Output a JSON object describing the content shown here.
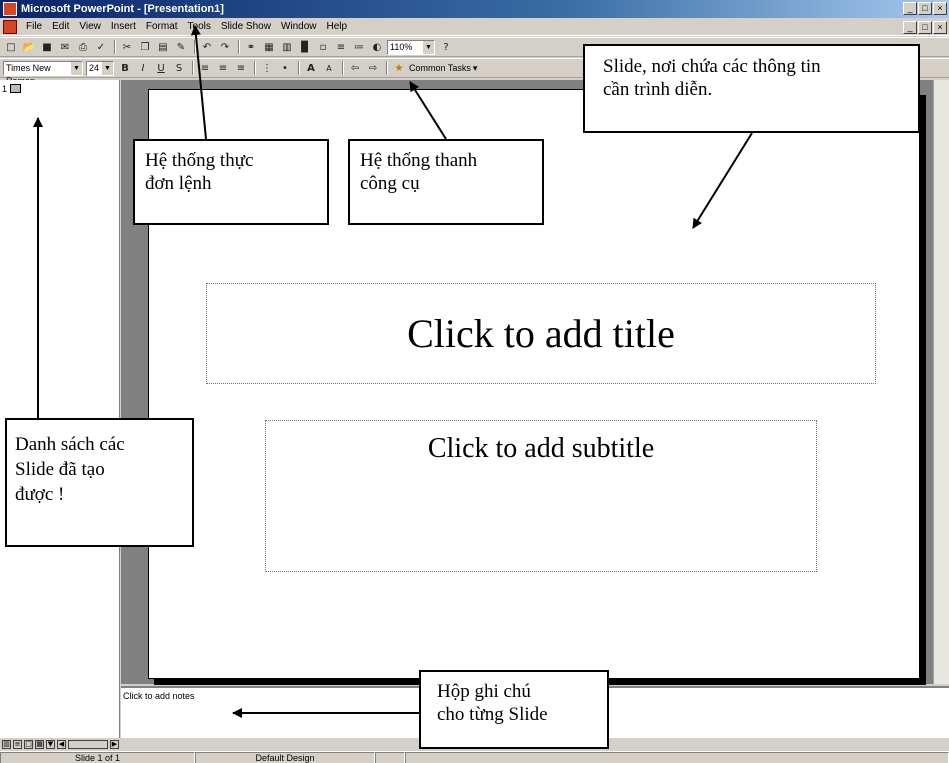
{
  "window": {
    "title": "Microsoft PowerPoint - [Presentation1]",
    "controls": [
      "_",
      "□",
      "×"
    ],
    "doc_controls": [
      "_",
      "□",
      "×"
    ]
  },
  "menu": {
    "items": [
      "File",
      "Edit",
      "View",
      "Insert",
      "Format",
      "Tools",
      "Slide Show",
      "Window",
      "Help"
    ]
  },
  "standard_toolbar": {
    "zoom": "110%",
    "help_icon": "?",
    "icons": [
      "new-icon",
      "open-icon",
      "save-icon",
      "email-icon",
      "print-icon",
      "spelling-icon",
      "cut-icon",
      "copy-icon",
      "paste-icon",
      "format-painter-icon",
      "undo-icon",
      "redo-icon",
      "hyperlink-icon",
      "tables-borders-icon",
      "insert-table-icon",
      "insert-chart-icon",
      "new-slide-icon",
      "expand-all-icon",
      "show-formatting-icon",
      "grayscale-icon",
      "zoom-icon",
      "help-icon"
    ]
  },
  "formatting_toolbar": {
    "font": "Times New Roman",
    "size": "24",
    "bold": "B",
    "italic": "I",
    "underline": "U",
    "shadow": "S",
    "increase_font": "A",
    "decrease_font": "A",
    "common_tasks": "Common Tasks"
  },
  "outline": {
    "slide_number": "1"
  },
  "slide": {
    "title_placeholder": "Click to add title",
    "subtitle_placeholder": "Click to add subtitle"
  },
  "notes": {
    "placeholder": "Click to add notes"
  },
  "status": {
    "slide_info": "Slide 1 of 1",
    "design": "Default Design"
  },
  "annotations": {
    "menu_system": [
      "Hệ thống thực",
      "đơn lệnh"
    ],
    "toolbar_system": [
      "Hệ thống thanh",
      "công cụ"
    ],
    "slide_desc": [
      "Slide, nơi chứa các thông tin",
      "cần trình diễn."
    ],
    "slide_list": [
      "Danh sách các",
      "Slide đã tạo",
      "được !"
    ],
    "notes_box": [
      "Hộp ghi chú",
      "cho từng Slide"
    ]
  }
}
